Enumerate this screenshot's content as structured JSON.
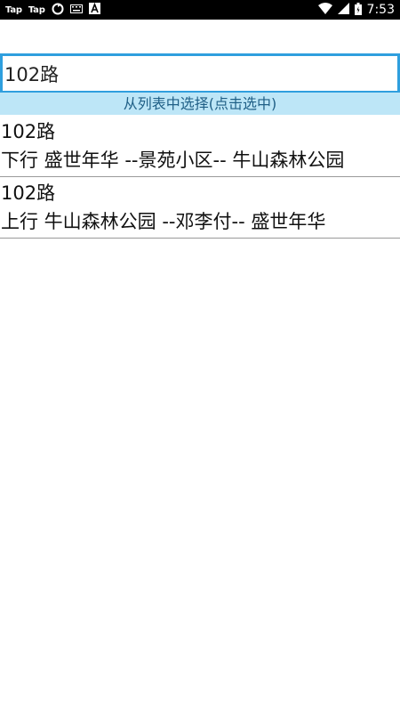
{
  "status_bar": {
    "app1": "Tap",
    "app2": "Tap",
    "time": "7:53"
  },
  "search": {
    "value": "102路"
  },
  "hint": "从列表中选择(点击选中)",
  "results": [
    {
      "title": "102路",
      "route": "下行 盛世年华 --景苑小区-- 牛山森林公园"
    },
    {
      "title": "102路",
      "route": "上行 牛山森林公园 --邓李付-- 盛世年华"
    }
  ]
}
